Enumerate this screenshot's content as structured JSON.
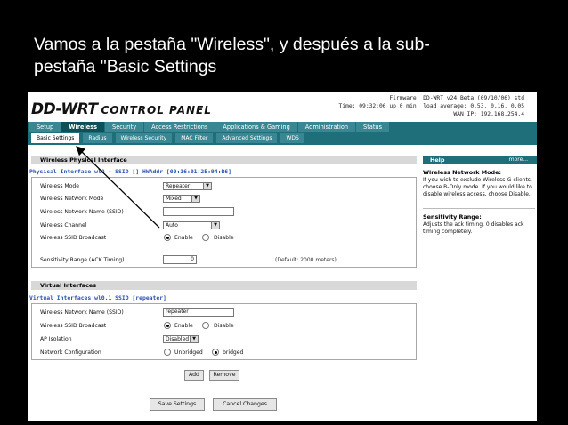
{
  "slide": {
    "title_line1": "Vamos a la pestaña \"Wireless\", y después a la sub-",
    "title_line2": "pestaña \"Basic Settings"
  },
  "header": {
    "logo_brand": "DD-WRT",
    "logo_subtitle": "CONTROL PANEL",
    "firmware": "Firmware: DD-WRT v24 Beta (09/10/06) std",
    "time": "Time: 09:32:06 up 0 min, load average: 0.53, 0.16, 0.05",
    "wan_ip": "WAN IP: 192.168.254.4"
  },
  "nav": {
    "tabs": [
      "Setup",
      "Wireless",
      "Security",
      "Access Restrictions",
      "Applications & Gaming",
      "Administration",
      "Status"
    ],
    "active": "Wireless"
  },
  "subnav": {
    "tabs": [
      "Basic Settings",
      "Radius",
      "Wireless Security",
      "MAC Filter",
      "Advanced Settings",
      "WDS"
    ],
    "active": "Basic Settings"
  },
  "physical": {
    "section_title": "Wireless Physical Interface",
    "iface_label": "Physical Interface wl0 - SSID [] HWAddr [00:16:01:2E:94:B6]",
    "mode_label": "Wireless Mode",
    "mode_value": "Repeater",
    "network_mode_label": "Wireless Network Mode",
    "network_mode_value": "Mixed",
    "ssid_label": "Wireless Network Name (SSID)",
    "ssid_value": "",
    "channel_label": "Wireless Channel",
    "channel_value": "Auto",
    "broadcast_label": "Wireless SSID Broadcast",
    "enable_label": "Enable",
    "disable_label": "Disable",
    "sensitivity_label": "Sensitivity Range (ACK Timing)",
    "sensitivity_value": "0",
    "sensitivity_hint": "(Default: 2000 meters)"
  },
  "virtual": {
    "section_title": "Virtual Interfaces",
    "iface_label": "Virtual Interfaces wl0.1 SSID [repeater]",
    "ssid_label": "Wireless Network Name (SSID)",
    "ssid_value": "repeater",
    "broadcast_label": "Wireless SSID Broadcast",
    "enable_label": "Enable",
    "disable_label": "Disable",
    "isolation_label": "AP Isolation",
    "isolation_value": "Disabled",
    "netconfig_label": "Network Configuration",
    "unbridged_label": "Unbridged",
    "bridged_label": "bridged",
    "add_label": "Add",
    "remove_label": "Remove"
  },
  "footer": {
    "save_label": "Save Settings",
    "cancel_label": "Cancel Changes"
  },
  "help": {
    "header": "Help",
    "more": "more...",
    "mode_title": "Wireless Network Mode:",
    "mode_text": "If you wish to exclude Wireless-G clients, choose B-Only mode. If you would like to disable wireless access, choose Disable.",
    "sens_title": "Sensitivity Range:",
    "sens_text": "Adjusts the ack timing. 0 disables ack timing completely."
  },
  "colors": {
    "nav_bg": "#1f6f7a",
    "nav_tab": "#3a8793",
    "nav_active": "#0f4f57",
    "iface_text": "#2a4fb0"
  }
}
